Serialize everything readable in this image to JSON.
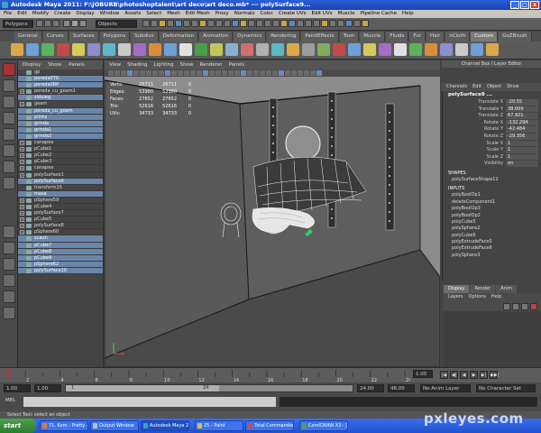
{
  "window": {
    "title": "Autodesk Maya 2011: F:\\JOBURB\\photoshoptalent\\art deco\\art deco.mb*  ---  polySurface9...",
    "buttons": [
      "_",
      "□",
      "x"
    ]
  },
  "menubar": [
    "File",
    "Edit",
    "Modify",
    "Create",
    "Display",
    "Window",
    "Assets",
    "Select",
    "Mesh",
    "Edit Mesh",
    "Proxy",
    "Normals",
    "Color",
    "Create UVs",
    "Edit UVs",
    "Muscle",
    "Pipeline Cache",
    "Help"
  ],
  "statusline": {
    "mode": "Polygons",
    "select_field": "Objects"
  },
  "shelf_tabs": [
    "General",
    "Curves",
    "Surfaces",
    "Polygons",
    "Subdivs",
    "Deformation",
    "Animation",
    "Dynamics",
    "Rendering",
    "PaintEffects",
    "Toon",
    "Muscle",
    "Fluids",
    "Fur",
    "Hair",
    "nCloth",
    "Custom",
    "GoZBrush"
  ],
  "shelf_active": "Custom",
  "shelf_icon_colors": [
    "#d9a84a",
    "#6fa0d6",
    "#5db35d",
    "#c24a4a",
    "#d6c85b",
    "#8c8cd0",
    "#5bb8c4",
    "#c9c9c9",
    "#a46cc4",
    "#d98c3a",
    "#6fa0d6",
    "#e0e0e0",
    "#4a9e4a",
    "#c4c45b",
    "#8ab0d0",
    "#d06f6f",
    "#b0b0b0",
    "#5bb8c4",
    "#d9a84a",
    "#9c9c9c",
    "#7fae5d",
    "#c24a4a",
    "#6fa0d6",
    "#d6c85b",
    "#a46cc4",
    "#e0e0e0",
    "#5db35d",
    "#d98c3a",
    "#8c8cd0",
    "#c9c9c9",
    "#6fa0d6",
    "#d9a84a"
  ],
  "outliner": {
    "menu": [
      "Display",
      "Show",
      "Panels"
    ],
    "rows": [
      {
        "label": "gp",
        "sel": false,
        "exp": false
      },
      {
        "label": "pereda0TG",
        "sel": true,
        "exp": false
      },
      {
        "label": "pereda0RP",
        "sel": true,
        "exp": false
      },
      {
        "label": "pereda_cu_geam1",
        "sel": false,
        "exp": true
      },
      {
        "label": "ziduieg",
        "sel": true,
        "exp": false
      },
      {
        "label": "geam",
        "sel": false,
        "exp": true
      },
      {
        "label": "pereda_cu_geam",
        "sel": true,
        "exp": false
      },
      {
        "label": "plinta",
        "sel": true,
        "exp": false
      },
      {
        "label": "grinda",
        "sel": true,
        "exp": false
      },
      {
        "label": "grinda1",
        "sel": true,
        "exp": false
      },
      {
        "label": "grinda2",
        "sel": true,
        "exp": false
      },
      {
        "label": "canapea",
        "sel": false,
        "exp": true
      },
      {
        "label": "pCube1",
        "sel": false,
        "exp": true
      },
      {
        "label": "pCube2",
        "sel": false,
        "exp": true
      },
      {
        "label": "pCube3",
        "sel": false,
        "exp": true
      },
      {
        "label": "canapea",
        "sel": false,
        "exp": true
      },
      {
        "label": "polySurface1",
        "sel": false,
        "exp": true
      },
      {
        "label": "polySurface6",
        "sel": true,
        "exp": false
      },
      {
        "label": "transform15",
        "sel": false,
        "exp": false
      },
      {
        "label": "masa",
        "sel": true,
        "exp": false
      },
      {
        "label": "pSphere59",
        "sel": false,
        "exp": true
      },
      {
        "label": "pCube4",
        "sel": false,
        "exp": true
      },
      {
        "label": "polySurface7",
        "sel": false,
        "exp": true
      },
      {
        "label": "pCube5",
        "sel": false,
        "exp": true
      },
      {
        "label": "polySurface8",
        "sel": false,
        "exp": true
      },
      {
        "label": "pSphere60",
        "sel": false,
        "exp": true
      },
      {
        "label": "scaun",
        "sel": true,
        "exp": false
      },
      {
        "label": "pCube7",
        "sel": true,
        "exp": false
      },
      {
        "label": "pCube8",
        "sel": true,
        "exp": false
      },
      {
        "label": "pCube9",
        "sel": true,
        "exp": false
      },
      {
        "label": "pSphere62",
        "sel": true,
        "exp": false
      },
      {
        "label": "polySurface10",
        "sel": true,
        "exp": false
      }
    ]
  },
  "viewport": {
    "menu": [
      "View",
      "Shading",
      "Lighting",
      "Show",
      "Renderer",
      "Panels"
    ],
    "hud": [
      {
        "label": "Verts:",
        "a": "26711",
        "b": "26711",
        "c": "0"
      },
      {
        "label": "Edges:",
        "a": "53980",
        "b": "53980",
        "c": "0"
      },
      {
        "label": "Faces:",
        "a": "27652",
        "b": "27652",
        "c": "0"
      },
      {
        "label": "Tris:",
        "a": "52616",
        "b": "52616",
        "c": "0"
      },
      {
        "label": "UVs:",
        "a": "34733",
        "b": "34733",
        "c": "0"
      }
    ]
  },
  "channelbox": {
    "header": "Channel Box / Layer Editor",
    "menu": [
      "Channels",
      "Edit",
      "Object",
      "Show"
    ],
    "object": "polySurface9 ...",
    "attrs": [
      {
        "name": "Translate X",
        "value": "-20.55"
      },
      {
        "name": "Translate Y",
        "value": "38.009"
      },
      {
        "name": "Translate Z",
        "value": "67.921"
      },
      {
        "name": "Rotate X",
        "value": "-132.294"
      },
      {
        "name": "Rotate Y",
        "value": "-42.484"
      },
      {
        "name": "Rotate Z",
        "value": "-29.356"
      },
      {
        "name": "Scale X",
        "value": "1"
      },
      {
        "name": "Scale Y",
        "value": "1"
      },
      {
        "name": "Scale Z",
        "value": "1"
      },
      {
        "name": "Visibility",
        "value": "on"
      }
    ],
    "shapes_label": "SHAPES",
    "shape": "polySurfaceShape12",
    "inputs_label": "INPUTS",
    "inputs": [
      "polyBoolOp1",
      "deleteComponent1",
      "polyBoolOp3",
      "polyBoolOp2",
      "polyCube5",
      "polySphere2",
      "polyCube6",
      "polyExtrudeFace5",
      "polyExtrudeFace6",
      "polySphere3"
    ]
  },
  "layers": {
    "tabs": [
      "Display",
      "Render",
      "Anim"
    ],
    "menu": [
      "Layers",
      "Options",
      "Help"
    ]
  },
  "timeline": {
    "ticks": [
      "2",
      "4",
      "6",
      "8",
      "10",
      "12",
      "14",
      "16",
      "18",
      "20",
      "22",
      "24"
    ],
    "current": "1.00",
    "play_buttons": [
      "|◀",
      "◀|",
      "◀",
      "▶",
      "▶|",
      "▶▶|"
    ]
  },
  "range": {
    "start": "1.00",
    "start2": "1.00",
    "box_left": "1",
    "box_right": "24",
    "end": "24.00",
    "end2": "48.00",
    "anim_layer": "No Anim Layer",
    "char_set": "No Character Set"
  },
  "mel_label": "MEL",
  "help_text": "Select Tool: select an object",
  "taskbar": {
    "start": "start",
    "tasks": [
      {
        "label": "71. Kom - Pretty - Wi...",
        "color": "#e07a30"
      },
      {
        "label": "Output Window",
        "color": "#c0c0c0"
      },
      {
        "label": "Autodesk Maya 2011...",
        "color": "#3fa0c8"
      },
      {
        "label": "25 - Paint",
        "color": "#e0c040"
      },
      {
        "label": "Total Commander 6.0...",
        "color": "#c05050"
      },
      {
        "label": "CorelDRAW X3 - [F:\\J...",
        "color": "#50a050"
      }
    ]
  },
  "watermark": "pxleyes.com"
}
